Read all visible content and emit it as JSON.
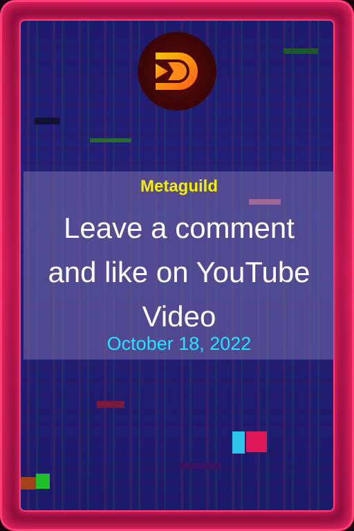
{
  "card": {
    "brand": "Metaguild",
    "title_lines": [
      "Leave a comment",
      "and like on YouTube",
      "Video"
    ],
    "date": "October 18, 2022",
    "logo_icon": "metaguild-logo-icon"
  },
  "colors": {
    "frame": "#b0144a",
    "frame_glow": "#ff3d7a",
    "screen_bg": "#1f1c72",
    "panel": "rgba(120,110,170,0.55)",
    "brand_text": "#f5f000",
    "title_text": "#ffffff",
    "date_text": "#22e6ff"
  }
}
